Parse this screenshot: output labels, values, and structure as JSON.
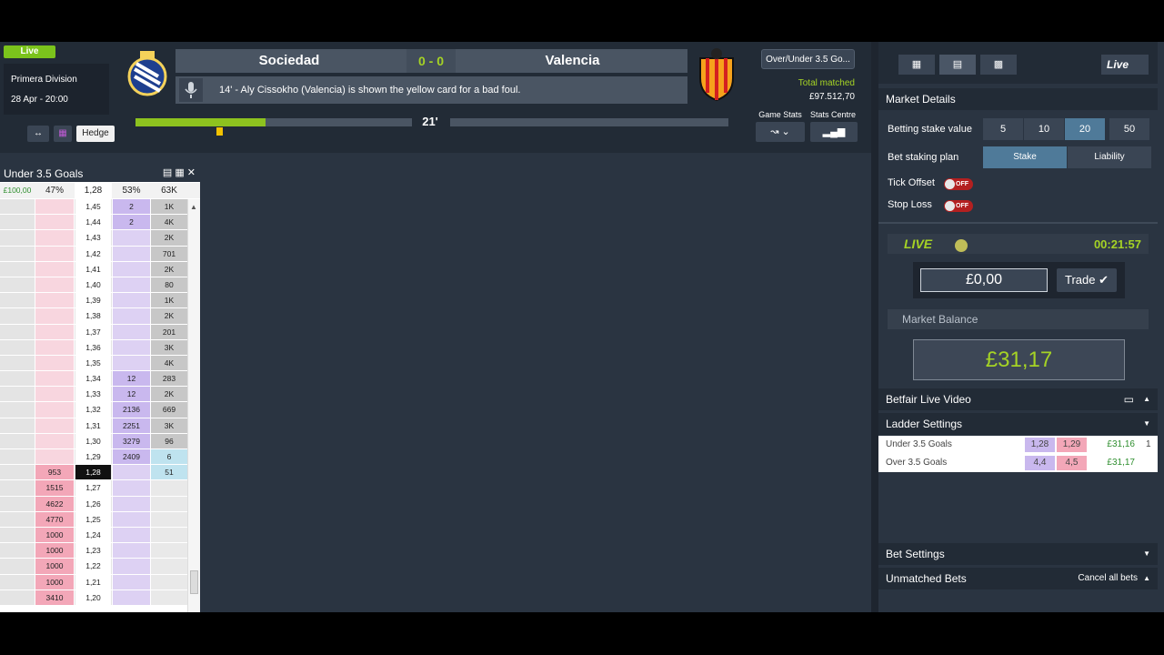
{
  "event": {
    "status": "Live",
    "competition": "Primera Division",
    "date": "28 Apr - 20:00",
    "home_team": "Sociedad",
    "away_team": "Valencia",
    "score": "0 - 0",
    "commentary": "14' - Aly Cissokho (Valencia) is shown the yellow card for a bad foul.",
    "minute": "21'",
    "match_progress": 0.47
  },
  "toolbar": {
    "hedge_label": "Hedge"
  },
  "market": {
    "name_button": "Over/Under 3.5 Go...",
    "total_matched_label": "Total matched",
    "total_matched": "£97.512,70",
    "game_stats_label": "Game Stats",
    "stats_centre_label": "Stats Centre"
  },
  "ladder": {
    "title": "Under 3.5 Goals",
    "summary": [
      "£100,00",
      "47%",
      "1,28",
      "53%",
      "63K"
    ],
    "rows": [
      [
        "",
        "",
        "1,45",
        "2",
        "1K"
      ],
      [
        "",
        "",
        "1,44",
        "2",
        "4K"
      ],
      [
        "",
        "",
        "1,43",
        "",
        "2K"
      ],
      [
        "",
        "",
        "1,42",
        "",
        "701"
      ],
      [
        "",
        "",
        "1,41",
        "",
        "2K"
      ],
      [
        "",
        "",
        "1,40",
        "",
        "80"
      ],
      [
        "",
        "",
        "1,39",
        "",
        "1K"
      ],
      [
        "",
        "",
        "1,38",
        "",
        "2K"
      ],
      [
        "",
        "",
        "1,37",
        "",
        "201"
      ],
      [
        "",
        "",
        "1,36",
        "",
        "3K"
      ],
      [
        "",
        "",
        "1,35",
        "",
        "4K"
      ],
      [
        "",
        "",
        "1,34",
        "12",
        "283"
      ],
      [
        "",
        "",
        "1,33",
        "12",
        "2K"
      ],
      [
        "",
        "",
        "1,32",
        "2136",
        "669"
      ],
      [
        "",
        "",
        "1,31",
        "2251",
        "3K"
      ],
      [
        "",
        "",
        "1,30",
        "3279",
        "96"
      ],
      [
        "",
        "",
        "1,29",
        "2409",
        "6"
      ],
      [
        "",
        "953",
        "1,28",
        "",
        "51"
      ],
      [
        "",
        "1515",
        "1,27",
        "",
        ""
      ],
      [
        "",
        "4622",
        "1,26",
        "",
        ""
      ],
      [
        "",
        "4770",
        "1,25",
        "",
        ""
      ],
      [
        "",
        "1000",
        "1,24",
        "",
        ""
      ],
      [
        "",
        "1000",
        "1,23",
        "",
        ""
      ],
      [
        "",
        "1000",
        "1,22",
        "",
        ""
      ],
      [
        "",
        "1000",
        "1,21",
        "",
        ""
      ],
      [
        "",
        "3410",
        "1,20",
        "",
        ""
      ]
    ]
  },
  "right_panel": {
    "live_label": "Live",
    "market_details_title": "Market Details",
    "betting_stake_label": "Betting stake value",
    "stakes": [
      "5",
      "10",
      "20",
      "50"
    ],
    "selected_stake": "20",
    "staking_plan_label": "Bet staking plan",
    "plan_options": [
      "Stake",
      "Liability"
    ],
    "tick_offset_label": "Tick Offset",
    "stop_loss_label": "Stop Loss",
    "toggle_off": "OFF",
    "live_word": "LIVE",
    "live_clock": "00:21:57",
    "trade_value": "£0,00",
    "trade_button": "Trade",
    "market_balance_label": "Market Balance",
    "market_balance": "£31,17",
    "betfair_video": "Betfair Live Video",
    "ladder_settings": "Ladder Settings",
    "runners": [
      {
        "name": "Under 3.5 Goals",
        "back": "1,28",
        "lay": "1,29",
        "pl": "£31,16",
        "idx": "1"
      },
      {
        "name": "Over 3.5 Goals",
        "back": "4,4",
        "lay": "4,5",
        "pl": "£31,17",
        "idx": ""
      }
    ],
    "bet_settings": "Bet Settings",
    "unmatched_bets": "Unmatched Bets",
    "cancel_all": "Cancel all bets"
  },
  "colors": {
    "accent_green": "#a5d325",
    "back": "#c9b8ee",
    "lay": "#f3a7b8"
  }
}
